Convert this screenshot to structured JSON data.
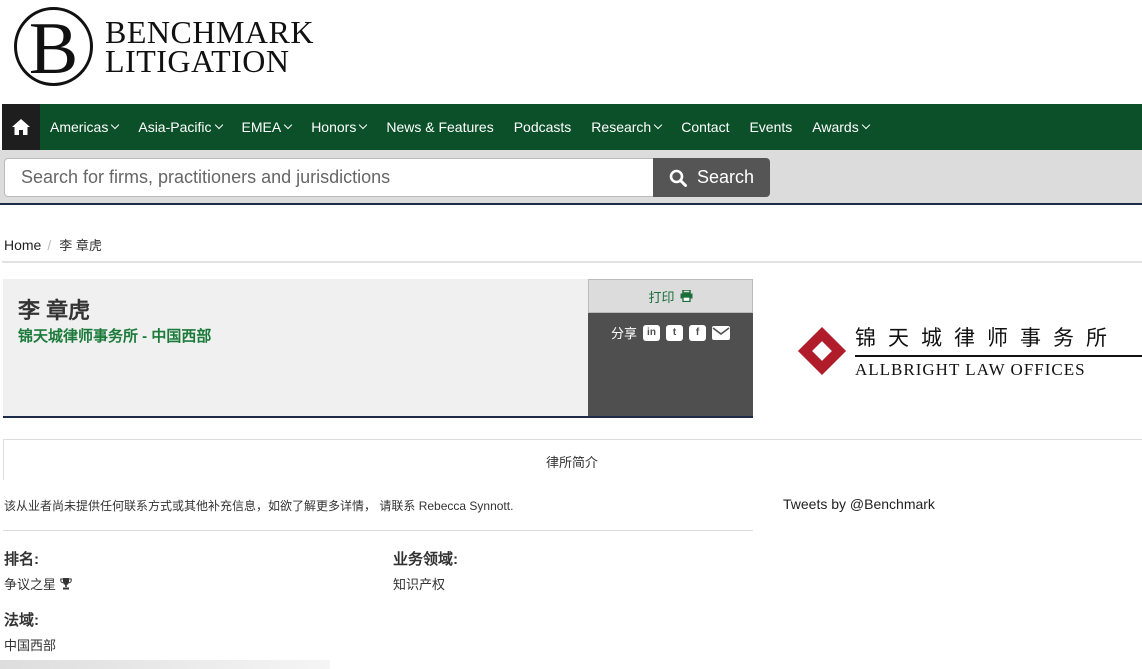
{
  "brand": {
    "letter": "B",
    "line1": "BENCHMARK",
    "line2": "LITIGATION"
  },
  "nav": {
    "items": [
      {
        "label": "Americas",
        "dropdown": true
      },
      {
        "label": "Asia-Pacific",
        "dropdown": true
      },
      {
        "label": "EMEA",
        "dropdown": true
      },
      {
        "label": "Honors",
        "dropdown": true
      },
      {
        "label": "News & Features",
        "dropdown": false
      },
      {
        "label": "Podcasts",
        "dropdown": false
      },
      {
        "label": "Research",
        "dropdown": true
      },
      {
        "label": "Contact",
        "dropdown": false
      },
      {
        "label": "Events",
        "dropdown": false
      },
      {
        "label": "Awards",
        "dropdown": true
      }
    ]
  },
  "search": {
    "placeholder": "Search for firms, practitioners and jurisdictions",
    "button": "Search"
  },
  "breadcrumb": {
    "home": "Home",
    "current": "李 章虎"
  },
  "profile": {
    "name": "李 章虎",
    "firm": "锦天城律师事务所 - 中国西部"
  },
  "actions": {
    "print": "打印",
    "share": "分享"
  },
  "firm_logo": {
    "cn": "锦天城律师事务所",
    "en": "ALLBRIGHT LAW OFFICES"
  },
  "tab": {
    "label": "律所简介"
  },
  "notice": {
    "text": "该从业者尚未提供任何联系方式或其他补充信息，如欲了解更多详情，",
    "link": "请联系 Rebecca Synnott."
  },
  "tweets": "Tweets by @Benchmark",
  "details": {
    "ranking_label": "排名:",
    "ranking_value": "争议之星",
    "practice_label": "业务领域:",
    "practice_value": "知识产权",
    "jurisdiction_label": "法域:",
    "jurisdiction_value": "中国西部"
  },
  "colors": {
    "nav_bg": "#0b5029",
    "accent_green": "#1b7a3a",
    "logo_red": "#b11c2a"
  }
}
